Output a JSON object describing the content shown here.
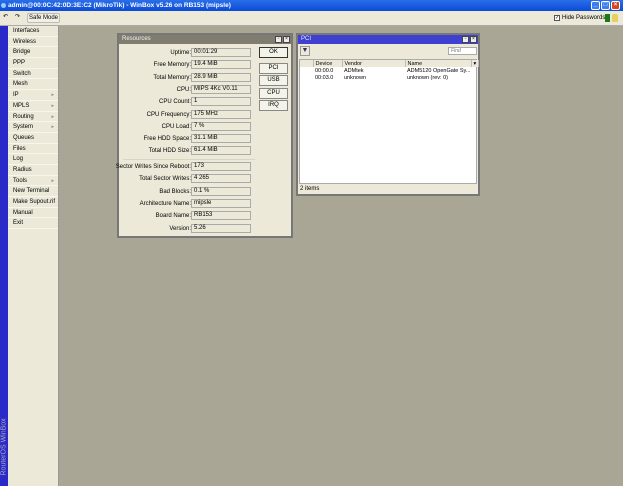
{
  "app": {
    "title": "admin@00:0C:42:0D:3E:C2 (MikroTik) - WinBox v5.26 on RB153 (mipsle)",
    "brand": "RouterOS WinBox"
  },
  "toolbar": {
    "safe_mode": "Safe Mode",
    "hide_passwords": "Hide Passwords",
    "hide_passwords_checked": true
  },
  "menu": [
    {
      "label": "Interfaces"
    },
    {
      "label": "Wireless"
    },
    {
      "label": "Bridge"
    },
    {
      "label": "PPP"
    },
    {
      "label": "Switch"
    },
    {
      "label": "Mesh"
    },
    {
      "label": "IP",
      "sub": true
    },
    {
      "label": "MPLS",
      "sub": true
    },
    {
      "label": "Routing",
      "sub": true
    },
    {
      "label": "System",
      "sub": true
    },
    {
      "label": "Queues"
    },
    {
      "label": "Files"
    },
    {
      "label": "Log"
    },
    {
      "label": "Radius"
    },
    {
      "label": "Tools",
      "sub": true
    },
    {
      "label": "New Terminal"
    },
    {
      "label": "Make Supout.rif"
    },
    {
      "label": "Manual"
    },
    {
      "label": "Exit"
    }
  ],
  "resources": {
    "title": "Resources",
    "fields": [
      {
        "label": "Uptime:",
        "value": "00:01:29"
      },
      {
        "label": "Free Memory:",
        "value": "19.4 MiB"
      },
      {
        "label": "Total Memory:",
        "value": "28.9 MiB"
      },
      {
        "label": "CPU:",
        "value": "MIPS 4Kc V0.11"
      },
      {
        "label": "CPU Count:",
        "value": "1"
      },
      {
        "label": "CPU Frequency:",
        "value": "175 MHz"
      },
      {
        "label": "CPU Load:",
        "value": "7 %"
      },
      {
        "label": "Free HDD Space:",
        "value": "31.1 MiB"
      },
      {
        "label": "Total HDD Size:",
        "value": "61.4 MiB"
      }
    ],
    "fields2": [
      {
        "label": "Sector Writes Since Reboot:",
        "value": "173"
      },
      {
        "label": "Total Sector Writes:",
        "value": "4 265"
      },
      {
        "label": "Bad Blocks:",
        "value": "0.1 %"
      },
      {
        "label": "Architecture Name:",
        "value": "mipsle"
      },
      {
        "label": "Board Name:",
        "value": "RB153"
      },
      {
        "label": "Version:",
        "value": "5.26"
      }
    ],
    "buttons": [
      "OK",
      "PCI",
      "USB",
      "CPU",
      "IRQ"
    ]
  },
  "pci": {
    "title": "PCI",
    "find_placeholder": "Find",
    "columns": [
      "Device",
      "Vendor",
      "Name"
    ],
    "rows": [
      {
        "device": "00:00.0",
        "vendor": "ADMtek",
        "name": "ADM5120 OpenGate Sy..."
      },
      {
        "device": "00:03.0",
        "vendor": "unknown",
        "name": "unknown (rev: 0)"
      }
    ],
    "status": "2 items"
  }
}
